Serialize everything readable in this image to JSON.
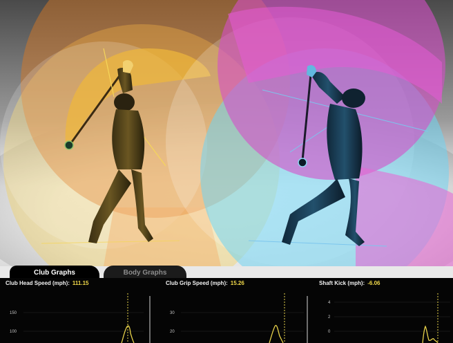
{
  "tabs": [
    {
      "label": "Club Graphs",
      "active": true
    },
    {
      "label": "Body Graphs",
      "active": false
    }
  ],
  "graphs": [
    {
      "title": "Club Head Speed (mph):",
      "value": "111.15",
      "ticks": [
        "150",
        "100"
      ]
    },
    {
      "title": "Club Grip Speed (mph):",
      "value": "15.26",
      "ticks": [
        "30",
        "20"
      ]
    },
    {
      "title": "Shaft Kick (mph):",
      "value": "-6.06",
      "ticks": [
        "4",
        "2",
        "0"
      ]
    }
  ],
  "colors": {
    "orange_arc": "#f0a33a",
    "magenta_arc": "#d64fc8",
    "cyan_arc": "#6fd4f2",
    "value_highlight": "#f0d84a",
    "graph_line": "#e8d24a"
  }
}
